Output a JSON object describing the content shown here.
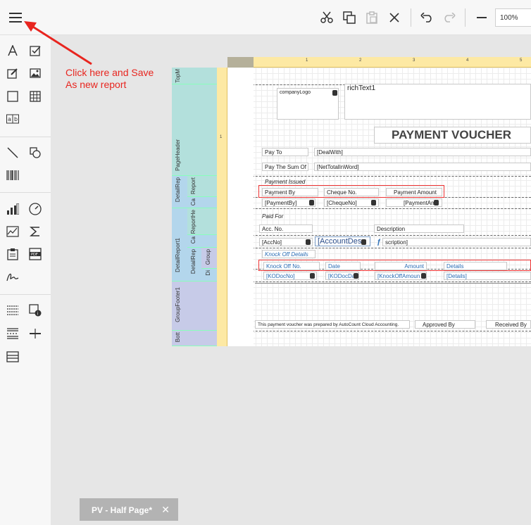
{
  "toolbar": {
    "zoom_value": "100%",
    "icons": [
      "menu-icon",
      "cut-icon",
      "copy-icon",
      "paste-icon",
      "delete-icon",
      "undo-icon",
      "redo-icon",
      "zoom-out-icon"
    ]
  },
  "annotation": {
    "line1": "Click here and Save",
    "line2": "As new report",
    "color": "#e8251f"
  },
  "bands": {
    "top_margin": "TopM",
    "page_header": "PageHeader",
    "detail_report": "DetailRep",
    "report": "Report",
    "ca": "Ca",
    "detail_report1": "DetailReport1",
    "report_header": "ReportHe",
    "ca2": "Ca",
    "detail_rep2": "DetailRep",
    "group": "Group",
    "di": "Di",
    "group_footer": "GroupFooter1",
    "bottom": "Bott"
  },
  "ruler": {
    "marks": [
      "1",
      "2",
      "3",
      "4",
      "5"
    ]
  },
  "report": {
    "company_logo": "companyLogo",
    "rich_text": "richText1",
    "title": "PAYMENT VOUCHER",
    "pay_to_label": "Pay To",
    "pay_to_value": "[DealWith]",
    "pay_sum_label": "Pay The Sum Of",
    "pay_sum_value": "[NetTotalInWord]",
    "payment_issued": "Payment Issued",
    "payment_by_label": "Payment By",
    "cheque_no_label": "Cheque No.",
    "payment_amount_label": "Payment Amount",
    "payment_by_value": "[PaymentBy]",
    "cheque_no_value": "[ChequeNo]",
    "payment_amount_value": "[PaymentAm",
    "paid_for": "Paid For",
    "acc_no_label": "Acc. No.",
    "description_label": "Description",
    "acc_no_value": "[AccNo]",
    "account_desc_value": "[AccountDesc",
    "description_value": "scription]",
    "knock_off_details": "Knock Off Details",
    "knock_off_no_label": "Knock Off No.",
    "date_label": "Date",
    "amount_label": "Amount",
    "details_label": "Details",
    "kodocno_value": "[KODocNo]",
    "kodocdate_value": "[KODocDa",
    "knockoffamount_value": "[KnockOffAmoun",
    "details_value": "[Details]",
    "footer_note": "This payment voucher was prepared by AutoCount Cloud Accounting.",
    "approved_by": "Approved By",
    "received_by": "Received By"
  },
  "tab": {
    "label": "PV - Half Page*",
    "close": "✕"
  }
}
